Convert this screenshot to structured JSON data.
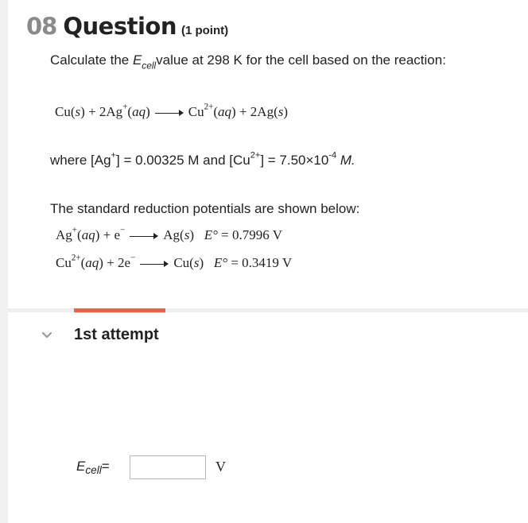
{
  "question": {
    "number": "08",
    "word": "Question",
    "points": "(1 point)"
  },
  "prompt": {
    "before": "Calculate the ",
    "e_symbol": "E",
    "e_sub": "cell",
    "after": "value at 298 K for the cell based on the reaction:"
  },
  "reaction": {
    "r1": "Cu",
    "r1_state": "s",
    "plus1": " + 2Ag",
    "r2_charge": "+",
    "r2_state": "aq",
    "p1": "Cu",
    "p1_charge": "2+",
    "p1_state": "aq",
    "plus2": " + 2Ag",
    "p2_state": "s"
  },
  "conditions": {
    "where": "where [Ag",
    "ag_charge": "+",
    "ag_value": "] = 0.00325 M and [Cu",
    "cu_charge": "2+",
    "cu_value": "] = 7.50×10",
    "exp": "-4",
    "unit": " M."
  },
  "potentials": {
    "heading": "The standard reduction potentials are shown below:",
    "half1": {
      "reactant": "Ag",
      "charge": "+",
      "state": "aq",
      "electrons": " + e",
      "product": "Ag",
      "product_state": "s",
      "e0_label": "E°",
      "e0_value": " = 0.7996 V"
    },
    "half2": {
      "reactant": "Cu",
      "charge": "2+",
      "state": "aq",
      "electrons": " + 2e",
      "product": "Cu",
      "product_state": "s",
      "e0_label": "E°",
      "e0_value": " = 0.3419 V"
    }
  },
  "attempt": {
    "label": "1st attempt",
    "answer_label_symbol": "E",
    "answer_label_sub": "cell",
    "answer_label_eq": "=",
    "answer_value": "",
    "unit": "V"
  },
  "colors": {
    "accent": "#e2664c",
    "question_number": "#8a8a8a",
    "divider": "#eeeeee"
  }
}
